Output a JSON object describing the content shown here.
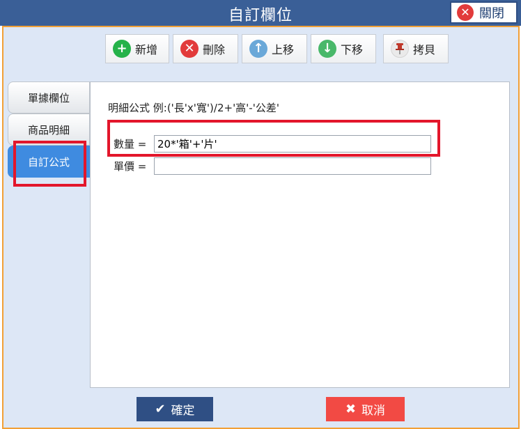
{
  "window": {
    "title": "自訂欄位",
    "close_label": "關閉"
  },
  "toolbar": {
    "add_label": "新增",
    "delete_label": "刪除",
    "move_up_label": "上移",
    "move_down_label": "下移",
    "copy_label": "拷貝"
  },
  "tabs": [
    {
      "label": "單據欄位",
      "active": false
    },
    {
      "label": "商品明細",
      "active": false
    },
    {
      "label": "自訂公式",
      "active": true
    }
  ],
  "content": {
    "hint": "明細公式 例:('長'x'寬')/2+'高'-'公差'",
    "quantity_label": "數量 =",
    "quantity_value": "20*'箱'+'片'",
    "unit_price_label": "單價 =",
    "unit_price_value": ""
  },
  "footer": {
    "ok_label": "確定",
    "cancel_label": "取消"
  },
  "colors": {
    "titlebar": "#3a5f97",
    "panel_border": "#f2a036",
    "active_tab": "#3f8be0",
    "highlight": "#e3162b",
    "ok_button": "#2f4f84",
    "cancel_button": "#f24a44"
  }
}
